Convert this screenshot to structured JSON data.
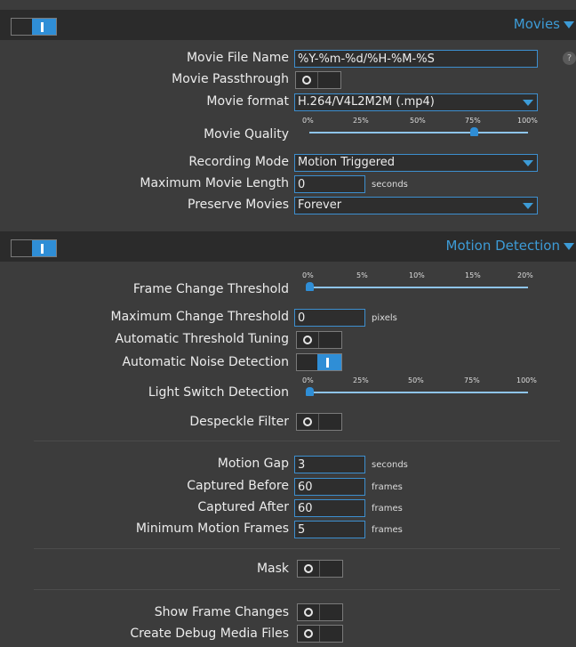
{
  "movies": {
    "title": "Movies",
    "file_name": {
      "label": "Movie File Name",
      "value": "%Y-%m-%d/%H-%M-%S"
    },
    "passthrough": {
      "label": "Movie Passthrough",
      "state": "off"
    },
    "format": {
      "label": "Movie format",
      "value": "H.264/V4L2M2M (.mp4)"
    },
    "quality": {
      "label": "Movie Quality",
      "ticks": [
        "0%",
        "25%",
        "50%",
        "75%",
        "100%"
      ],
      "value_percent": 75
    },
    "recording_mode": {
      "label": "Recording Mode",
      "value": "Motion Triggered"
    },
    "max_length": {
      "label": "Maximum Movie Length",
      "value": "0",
      "unit": "seconds"
    },
    "preserve": {
      "label": "Preserve Movies",
      "value": "Forever"
    }
  },
  "motion": {
    "title": "Motion Detection",
    "frame_change": {
      "label": "Frame Change Threshold",
      "ticks": [
        "0%",
        "5%",
        "10%",
        "15%",
        "20%"
      ],
      "value_percent": 0
    },
    "max_change": {
      "label": "Maximum Change Threshold",
      "value": "0",
      "unit": "pixels"
    },
    "auto_threshold": {
      "label": "Automatic Threshold Tuning",
      "state": "off"
    },
    "auto_noise": {
      "label": "Automatic Noise Detection",
      "state": "on"
    },
    "light_switch": {
      "label": "Light Switch Detection",
      "ticks": [
        "0%",
        "25%",
        "50%",
        "75%",
        "100%"
      ],
      "value_percent": 0
    },
    "despeckle": {
      "label": "Despeckle Filter",
      "state": "off"
    },
    "motion_gap": {
      "label": "Motion Gap",
      "value": "3",
      "unit": "seconds"
    },
    "captured_before": {
      "label": "Captured Before",
      "value": "60",
      "unit": "frames"
    },
    "captured_after": {
      "label": "Captured After",
      "value": "60",
      "unit": "frames"
    },
    "min_frames": {
      "label": "Minimum Motion Frames",
      "value": "5",
      "unit": "frames"
    },
    "mask": {
      "label": "Mask",
      "state": "off"
    },
    "show_frame_changes": {
      "label": "Show Frame Changes",
      "state": "off"
    },
    "debug_media": {
      "label": "Create Debug Media Files",
      "state": "off"
    }
  },
  "help_icon": "?",
  "colors": {
    "accent": "#3d9bd6",
    "toggle_on": "#2f8ed6",
    "background": "#3c3c3c",
    "header": "#2b2b2b"
  }
}
